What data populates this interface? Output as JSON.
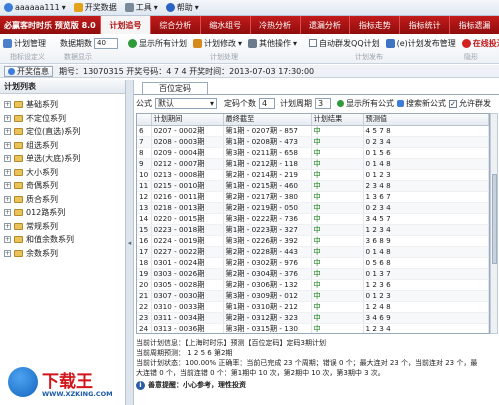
{
  "menubar": {
    "user": "aaaaaa111",
    "items": [
      "开奖数据",
      "工具",
      "帮助"
    ]
  },
  "app": {
    "title": "必赢客时时乐 预览版 8.0"
  },
  "main_tabs": [
    "计划追号",
    "综合分析",
    "缩水组号",
    "冷热分析",
    "遗漏分析",
    "指标走势",
    "指标统计",
    "指标遗漏"
  ],
  "toolbar": {
    "plan_manage": "计划管理",
    "period_label": "数据期数",
    "period_value": "40",
    "show_all_plans": "显示所有计划",
    "plan_edit": "计划修改",
    "other_ops": "其他操作",
    "auto_qq": "自动群发QQ计划",
    "plan_publish_manage": "(e)计划发布管理",
    "online_download": "在线投注",
    "row2": [
      "指标设定义",
      "数据显示",
      "计划处理",
      "计划发布",
      "隐形"
    ]
  },
  "infobar": {
    "open_btn": "开奖信息",
    "text": "期号：13070315 开奖号码：4 7 4 开奖时间：2013-07-03 17:30:00"
  },
  "left": {
    "header": "计划列表",
    "items": [
      "基础系列",
      "不定位系列",
      "定位(直选)系列",
      "组选系列",
      "单选(大底)系列",
      "大小系列",
      "奇偶系列",
      "质合系列",
      "012路系列",
      "常规系列",
      "和值余数系列",
      "余数系列"
    ]
  },
  "right": {
    "subtab": "百位定码",
    "form": {
      "formula_label": "公式",
      "formula_value": "默认",
      "fix_code_label": "定码个数",
      "fix_code_value": "4",
      "plan_period_label": "计划周期",
      "plan_period_value": "3",
      "show_all_formula": "显示所有公式",
      "search_formula": "搜索新公式",
      "allow_group": "允许群发"
    },
    "columns": [
      "",
      "计划期间",
      "最终截至",
      "计划结果",
      "预测值"
    ],
    "rows": [
      [
        "6",
        "0207 - 0002期",
        "第1期 - 0207期 - 857",
        "中",
        "4 5 7 8"
      ],
      [
        "7",
        "0208 - 0003期",
        "第1期 - 0208期 - 473",
        "中",
        "0 2 3 4"
      ],
      [
        "8",
        "0209 - 0004期",
        "第3期 - 0211期 - 658",
        "中",
        "0 1 5 6"
      ],
      [
        "9",
        "0212 - 0007期",
        "第1期 - 0212期 - 118",
        "中",
        "0 1 4 8"
      ],
      [
        "10",
        "0213 - 0008期",
        "第2期 - 0214期 - 219",
        "中",
        "0 1 2 3"
      ],
      [
        "11",
        "0215 - 0010期",
        "第1期 - 0215期 - 460",
        "中",
        "2 3 4 8"
      ],
      [
        "12",
        "0216 - 0011期",
        "第2期 - 0217期 - 380",
        "中",
        "1 3 6 7"
      ],
      [
        "13",
        "0218 - 0013期",
        "第2期 - 0219期 - 050",
        "中",
        "0 2 3 4"
      ],
      [
        "14",
        "0220 - 0015期",
        "第3期 - 0222期 - 736",
        "中",
        "3 4 5 7"
      ],
      [
        "15",
        "0223 - 0018期",
        "第1期 - 0223期 - 327",
        "中",
        "1 2 3 4"
      ],
      [
        "16",
        "0224 - 0019期",
        "第3期 - 0226期 - 392",
        "中",
        "3 6 8 9"
      ],
      [
        "17",
        "0227 - 0022期",
        "第2期 - 0228期 - 443",
        "中",
        "0 1 4 8"
      ],
      [
        "18",
        "0301 - 0024期",
        "第2期 - 0302期 - 976",
        "中",
        "0 5 6 8"
      ],
      [
        "19",
        "0303 - 0026期",
        "第2期 - 0304期 - 376",
        "中",
        "0 1 3 7"
      ],
      [
        "20",
        "0305 - 0028期",
        "第2期 - 0306期 - 132",
        "中",
        "1 2 3 6"
      ],
      [
        "21",
        "0307 - 0030期",
        "第3期 - 0309期 - 012",
        "中",
        "0 1 2 3"
      ],
      [
        "22",
        "0310 - 0033期",
        "第1期 - 0310期 - 212",
        "中",
        "1 2 4 8"
      ],
      [
        "23",
        "0311 - 0034期",
        "第2期 - 0312期 - 323",
        "中",
        "3 4 6 9"
      ],
      [
        "24",
        "0313 - 0036期",
        "第3期 - 0315期 - 130",
        "中",
        "1 2 3 4"
      ],
      [
        "24",
        "0316 - 0039期",
        "第2期 - 0317期进行中...",
        "等开",
        "1 2 5 6"
      ]
    ],
    "summary": [
      "当前计划信息：【上海时时乐】预测【百位定码】定码3期计划",
      "当前周期预测：  1 2 5 6   第2期",
      "当前计划状态：100.00% 正确率：当前已完成 23 个周期；错误 0 个；最大连对 23 个，当前连对 23 个，最",
      "大连错 0 个，当前连错 0 个：第1期中 10 次，第2期中 10 次，第3期中 3 次。"
    ],
    "tip": "善意提醒：小心参考，理性投资"
  },
  "watermark": {
    "name": "下载王",
    "url": "WWW.XZKING.COM"
  },
  "colors": {
    "tab_red": "#b01010",
    "hit_green": "#0a7a0a"
  }
}
